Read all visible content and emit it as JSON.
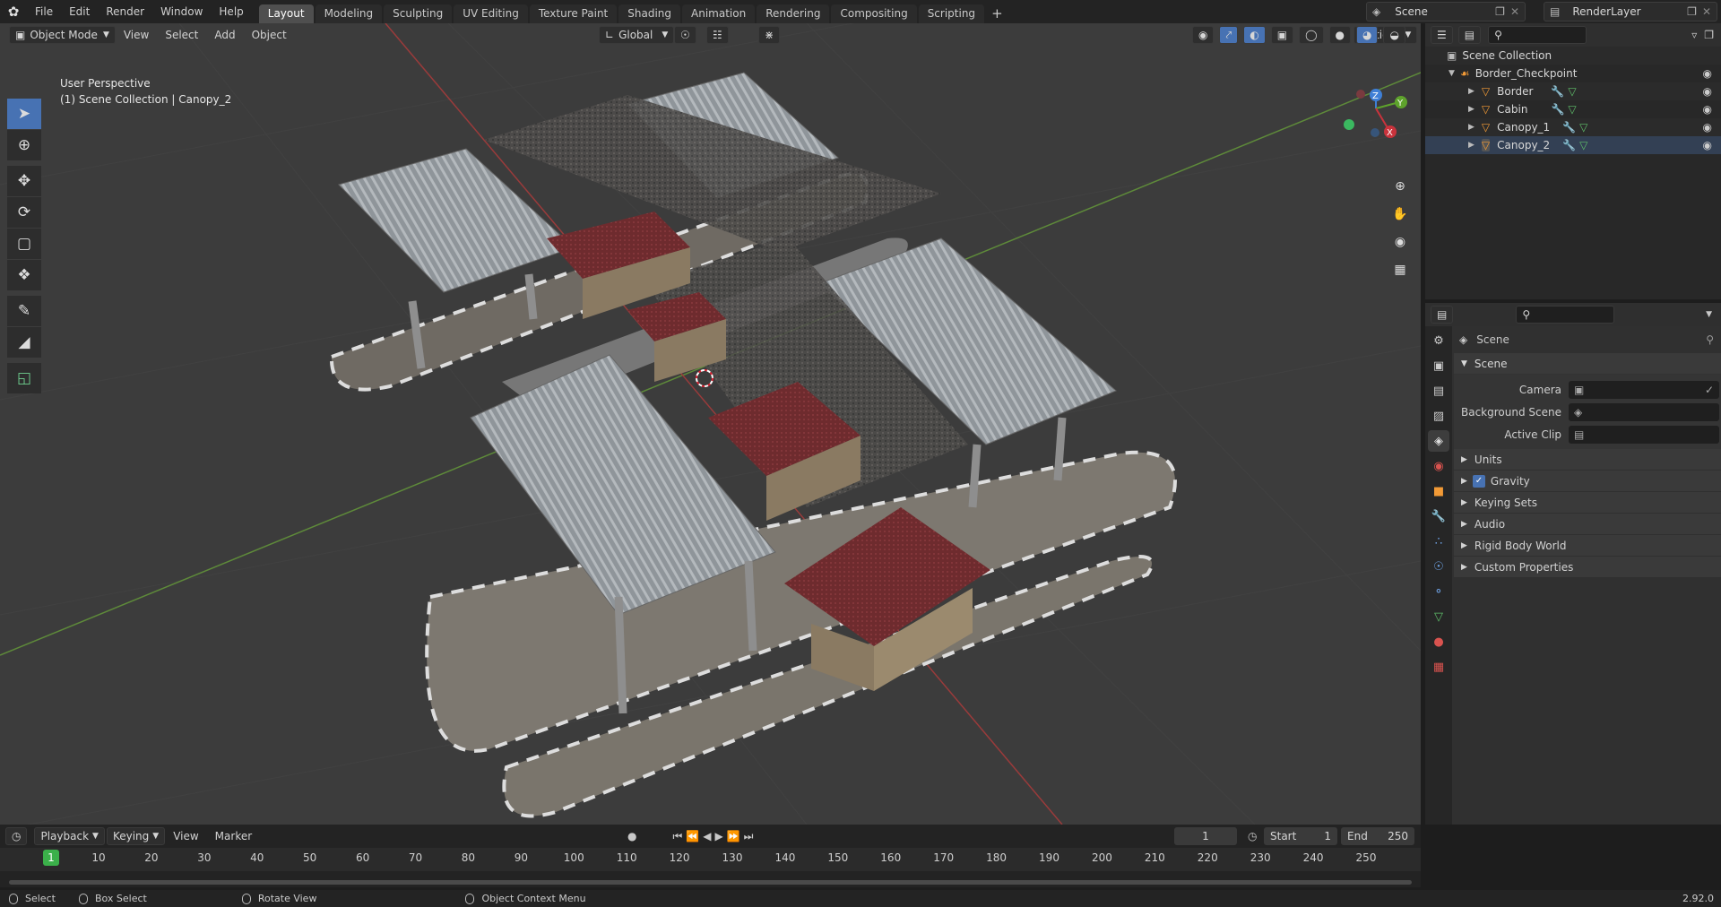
{
  "topbar": {
    "menus": [
      "File",
      "Edit",
      "Render",
      "Window",
      "Help"
    ],
    "workspaces": [
      "Layout",
      "Modeling",
      "Sculpting",
      "UV Editing",
      "Texture Paint",
      "Shading",
      "Animation",
      "Rendering",
      "Compositing",
      "Scripting"
    ],
    "add_tab": "+",
    "scene": "Scene",
    "render_layer": "RenderLayer"
  },
  "viewport": {
    "mode": "Object Mode",
    "menus": [
      "View",
      "Select",
      "Add",
      "Object"
    ],
    "transform_orientation": "Global",
    "options": "Options",
    "info_line1": "User Perspective",
    "info_line2": "(1) Scene Collection | Canopy_2",
    "gizmo": {
      "z": "Z",
      "y": "Y",
      "x": "X"
    }
  },
  "outliner": {
    "root": "Scene Collection",
    "collection": "Border_Checkpoint",
    "objects": [
      "Border",
      "Cabin",
      "Canopy_1",
      "Canopy_2"
    ]
  },
  "properties": {
    "header": "Scene",
    "panel": "Scene",
    "camera_label": "Camera",
    "background_scene_label": "Background Scene",
    "active_clip_label": "Active Clip",
    "subpanels": [
      "Units",
      "Gravity",
      "Keying Sets",
      "Audio",
      "Rigid Body World",
      "Custom Properties"
    ],
    "gravity_checked": true
  },
  "timeline": {
    "menus": [
      "Playback",
      "Keying",
      "View",
      "Marker"
    ],
    "current_frame": "1",
    "start_label": "Start",
    "start": "1",
    "end_label": "End",
    "end": "250",
    "ticks": [
      "1",
      "10",
      "20",
      "30",
      "40",
      "50",
      "60",
      "70",
      "80",
      "90",
      "100",
      "110",
      "120",
      "130",
      "140",
      "150",
      "160",
      "170",
      "180",
      "190",
      "200",
      "210",
      "220",
      "230",
      "240",
      "250"
    ]
  },
  "statusbar": {
    "select": "Select",
    "box_select": "Box Select",
    "rotate_view": "Rotate View",
    "context_menu": "Object Context Menu",
    "version": "2.92.0"
  },
  "colors": {
    "accent": "#4772b3",
    "x_axis": "#c9333c",
    "y_axis": "#5ea32c",
    "z_axis": "#3f7fd6",
    "object_orange": "#f29a36"
  }
}
